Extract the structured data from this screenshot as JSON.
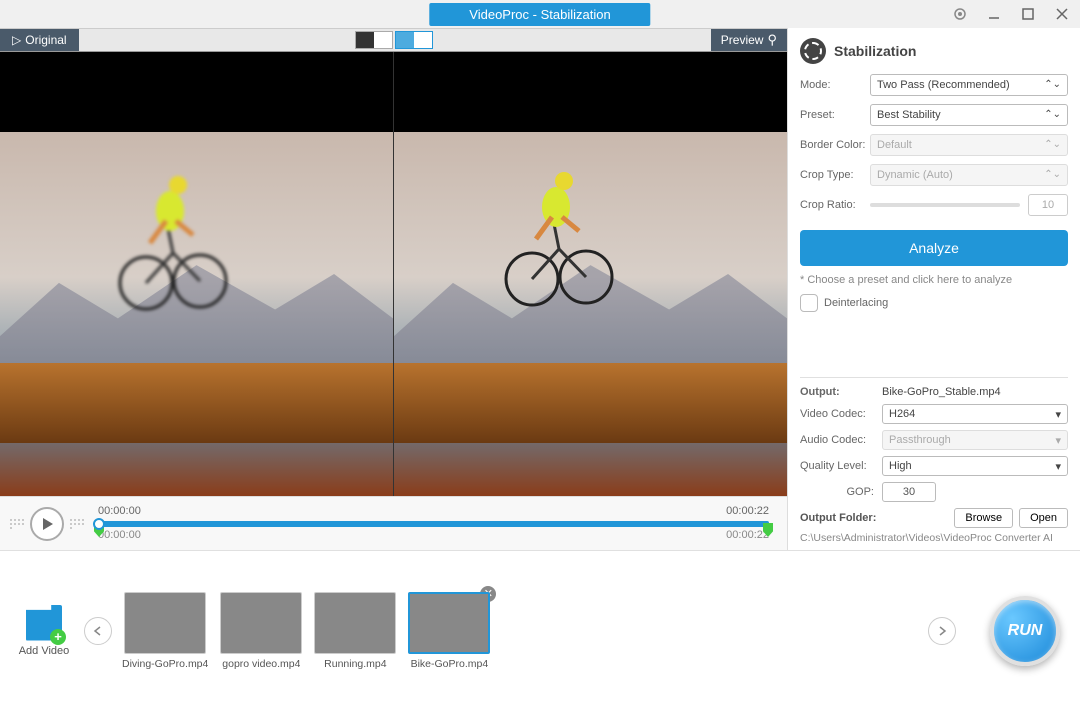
{
  "title": "VideoProc - Stabilization",
  "tabs": {
    "original": "Original",
    "preview": "Preview"
  },
  "panel": {
    "heading": "Stabilization",
    "mode_label": "Mode:",
    "mode_value": "Two Pass (Recommended)",
    "preset_label": "Preset:",
    "preset_value": "Best Stability",
    "border_label": "Border Color:",
    "border_value": "Default",
    "croptype_label": "Crop Type:",
    "croptype_value": "Dynamic (Auto)",
    "cropratio_label": "Crop Ratio:",
    "cropratio_value": "10",
    "analyze": "Analyze",
    "hint": "* Choose a preset and click here to analyze",
    "deinterlace": "Deinterlacing"
  },
  "output": {
    "output_label": "Output:",
    "output_name": "Bike-GoPro_Stable.mp4",
    "vcodec_label": "Video Codec:",
    "vcodec_value": "H264",
    "acodec_label": "Audio Codec:",
    "acodec_value": "Passthrough",
    "quality_label": "Quality Level:",
    "quality_value": "High",
    "gop_label": "GOP:",
    "gop_value": "30",
    "folder_label": "Output Folder:",
    "browse": "Browse",
    "open": "Open",
    "path": "C:\\Users\\Administrator\\Videos\\VideoProc Converter AI"
  },
  "timeline": {
    "start": "00:00:00",
    "end": "00:00:22",
    "pos": "00:00:00",
    "total": "00:00:22"
  },
  "thumbs": {
    "add": "Add Video",
    "t1": "Diving-GoPro.mp4",
    "t2": "gopro video.mp4",
    "t3": "Running.mp4",
    "t4": "Bike-GoPro.mp4"
  },
  "run": "RUN"
}
